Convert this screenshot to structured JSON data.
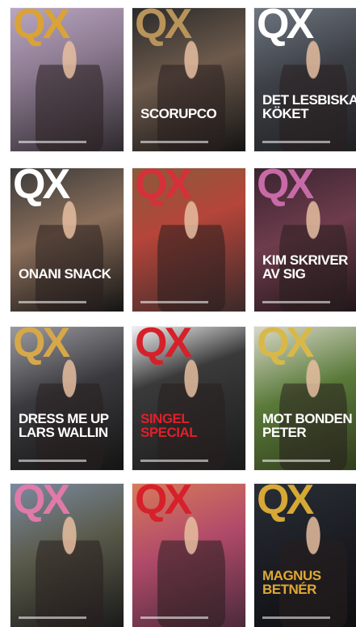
{
  "covers": [
    {
      "logo": "QX",
      "logo_color": "#d9a336",
      "bg": "linear-gradient(160deg,#b9a6c2 0%,#8c7a90 40%,#2e2a2e 100%)",
      "headline": "",
      "headline_color": "#e8b23a",
      "sub": ""
    },
    {
      "logo": "QX",
      "logo_color": "#b8935a",
      "bg": "linear-gradient(160deg,#2a2a2a 0%,#6d5a4c 45%,#141414 100%)",
      "headline": "SCORUPCO",
      "headline_color": "#ffffff",
      "sub": ""
    },
    {
      "logo": "QX",
      "logo_color": "#ffffff",
      "bg": "linear-gradient(160deg,#6f7680 0%,#3c3f45 45%,#1f1f22 100%)",
      "headline": "DET LESBISKA KÖKET",
      "headline_color": "#ffffff",
      "sub": ""
    },
    {
      "logo": "QX",
      "logo_color": "#ffffff",
      "bg": "linear-gradient(160deg,#3a3a3a 0%,#8a6e5a 45%,#141414 100%)",
      "headline": "ONANI SNACK",
      "headline_color": "#ffffff",
      "sub": ""
    },
    {
      "logo": "QX",
      "logo_color": "#d6303a",
      "bg": "linear-gradient(160deg,#8a5a3a 0%,#b5453a 40%,#3a2a2a 100%)",
      "headline": "",
      "headline_color": "#e0302a",
      "sub": ""
    },
    {
      "logo": "QX",
      "logo_color": "#c86aa8",
      "bg": "linear-gradient(160deg,#3a2430 0%,#6e3c4c 45%,#1e1418 100%)",
      "headline": "KIM SKRIVER AV SIG",
      "headline_color": "#ffffff",
      "sub": ""
    },
    {
      "logo": "QX",
      "logo_color": "#d6a84a",
      "bg": "linear-gradient(160deg,#9a9aa0 0%,#3a3a3e 45%,#141414 100%)",
      "headline": "DRESS ME UP LARS WALLIN",
      "headline_color": "#ffffff",
      "sub": ""
    },
    {
      "logo": "QX",
      "logo_color": "#d6202a",
      "bg": "linear-gradient(160deg,#f2f2f2 0%,#3a3a3a 35%,#1a1a1a 100%)",
      "headline": "SINGEL SPECIAL",
      "headline_color": "#e0202a",
      "sub": ""
    },
    {
      "logo": "QX",
      "logo_color": "#d9b84a",
      "bg": "linear-gradient(160deg,#d8d8c8 0%,#5a7a3a 45%,#2e3a1a 100%)",
      "headline": "MOT BONDEN PETER",
      "headline_color": "#ffffff",
      "sub": ""
    },
    {
      "logo": "QX",
      "logo_color": "#e07aa8",
      "bg": "linear-gradient(160deg,#7a8aa0 0%,#5a5a4a 45%,#1a1a1a 100%)",
      "headline": "",
      "headline_color": "#e04a9a",
      "sub": ""
    },
    {
      "logo": "QX",
      "logo_color": "#d6202a",
      "bg": "linear-gradient(160deg,#d87a5a 0%,#b04a6a 45%,#4a2a3a 100%)",
      "headline": "",
      "headline_color": "#e02a2a",
      "sub": ""
    },
    {
      "logo": "QX",
      "logo_color": "#d6a836",
      "bg": "linear-gradient(160deg,#2a2e36 0%,#1a1c22 50%,#0e0e10 100%)",
      "headline": "MAGNUS BETNÉR",
      "headline_color": "#e0a834",
      "sub": ""
    }
  ]
}
